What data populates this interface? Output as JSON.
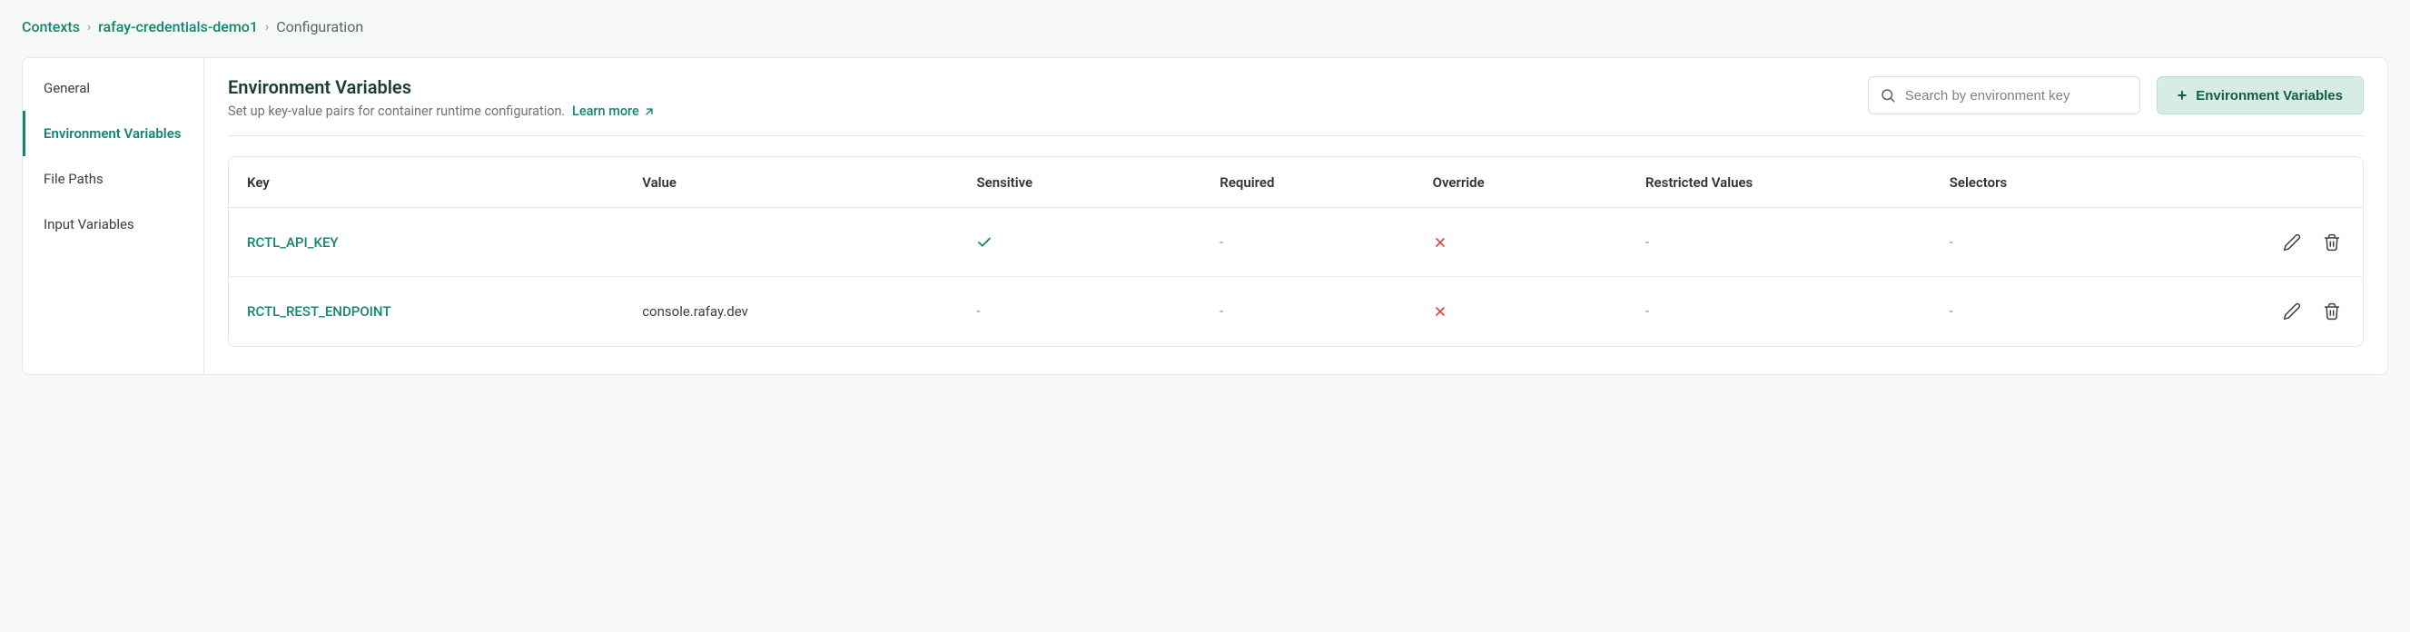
{
  "breadcrumb": {
    "root": "Contexts",
    "item": "rafay-credentials-demo1",
    "current": "Configuration"
  },
  "sidebar": {
    "items": [
      {
        "label": "General"
      },
      {
        "label": "Environment Variables"
      },
      {
        "label": "File Paths"
      },
      {
        "label": "Input Variables"
      }
    ]
  },
  "header": {
    "title": "Environment Variables",
    "subtitle": "Set up key-value pairs for container runtime configuration.",
    "learn_more": "Learn more"
  },
  "search": {
    "placeholder": "Search by environment key"
  },
  "add_button": {
    "label": "Environment Variables"
  },
  "table": {
    "columns": {
      "key": "Key",
      "value": "Value",
      "sensitive": "Sensitive",
      "required": "Required",
      "override": "Override",
      "restricted": "Restricted Values",
      "selectors": "Selectors"
    },
    "rows": [
      {
        "key": "RCTL_API_KEY",
        "value": "",
        "sensitive": "check",
        "required": "-",
        "override": "x",
        "restricted": "-",
        "selectors": "-"
      },
      {
        "key": "RCTL_REST_ENDPOINT",
        "value": "console.rafay.dev",
        "sensitive": "-",
        "required": "-",
        "override": "x",
        "restricted": "-",
        "selectors": "-"
      }
    ]
  }
}
